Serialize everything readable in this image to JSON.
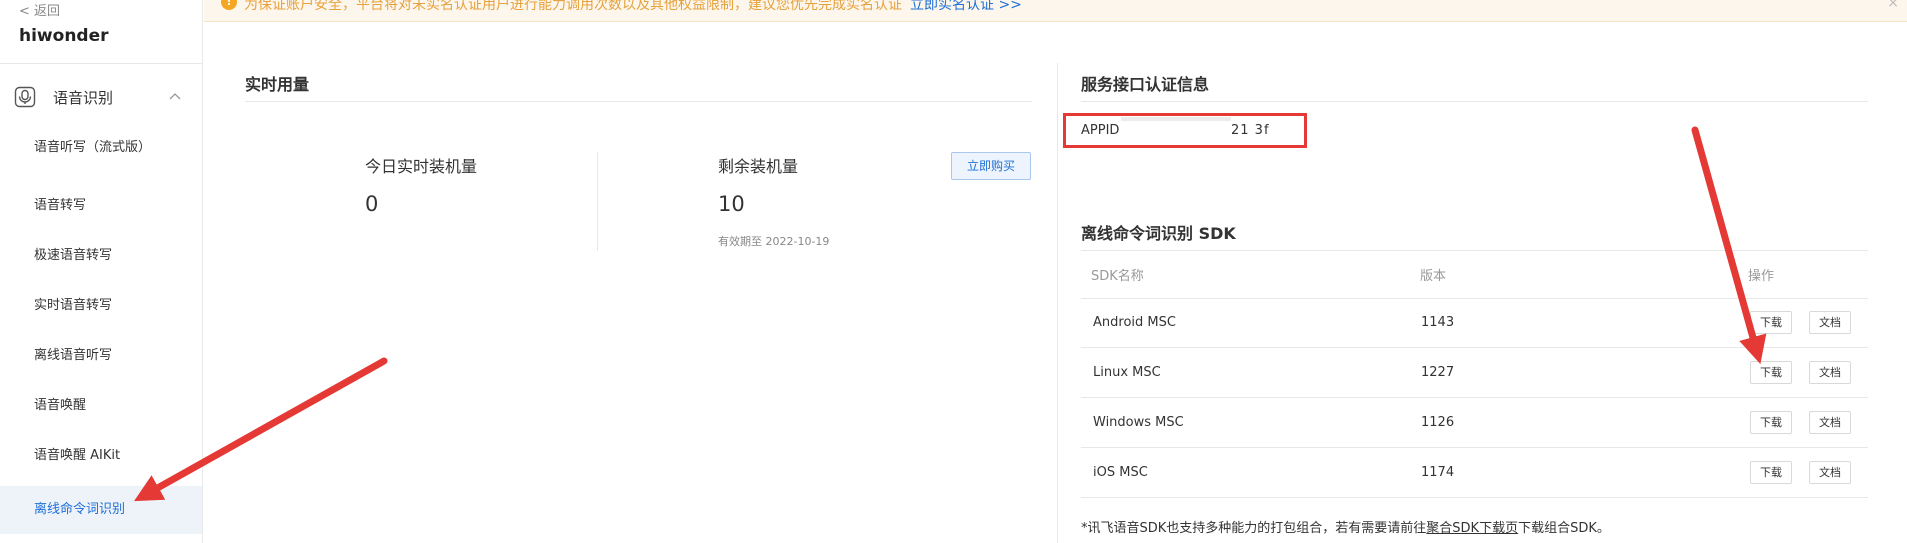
{
  "sidebar": {
    "back_label": "< 返回",
    "app_name": "hiwonder",
    "group_label": "语音识别",
    "items": [
      {
        "label": "语音听写（流式版）"
      },
      {
        "label": "语音转写"
      },
      {
        "label": "极速语音转写"
      },
      {
        "label": "实时语音转写"
      },
      {
        "label": "离线语音听写"
      },
      {
        "label": "语音唤醒"
      },
      {
        "label": "语音唤醒 AIKit"
      },
      {
        "label": "离线命令词识别"
      }
    ]
  },
  "notice": {
    "icon": "!",
    "text": "为保证账户安全，平台将对未实名认证用户进行能力调用次数以及其他权益限制，建议您优先完成实名认证",
    "link": "立即实名认证 >>",
    "close": "×"
  },
  "realtime": {
    "title": "实时用量",
    "today_label": "今日实时装机量",
    "today_value": "0",
    "remain_label": "剩余装机量",
    "remain_value": "10",
    "expiry": "有效期至 2022-10-19",
    "buy_label": "立即购买"
  },
  "auth": {
    "title": "服务接口认证信息",
    "appid_label": "APPID",
    "appid_value": "21   3f"
  },
  "sdk": {
    "title": "离线命令词识别 SDK",
    "headers": {
      "name": "SDK名称",
      "version": "版本",
      "action": "操作"
    },
    "rows": [
      {
        "name": "Android MSC",
        "version": "1143"
      },
      {
        "name": "Linux MSC",
        "version": "1227"
      },
      {
        "name": "Windows MSC",
        "version": "1126"
      },
      {
        "name": "iOS MSC",
        "version": "1174"
      }
    ],
    "download_label": "下载",
    "doc_label": "文档",
    "footnote_prefix": "*讯飞语音SDK也支持多种能力的打包组合，若有需要请前往",
    "footnote_link": "聚合SDK下载页",
    "footnote_suffix": "下载组合SDK。"
  },
  "colors": {
    "accent": "#1e6fd6",
    "annotation_arrow": "#e53935",
    "notice_text": "#e6a23c"
  }
}
